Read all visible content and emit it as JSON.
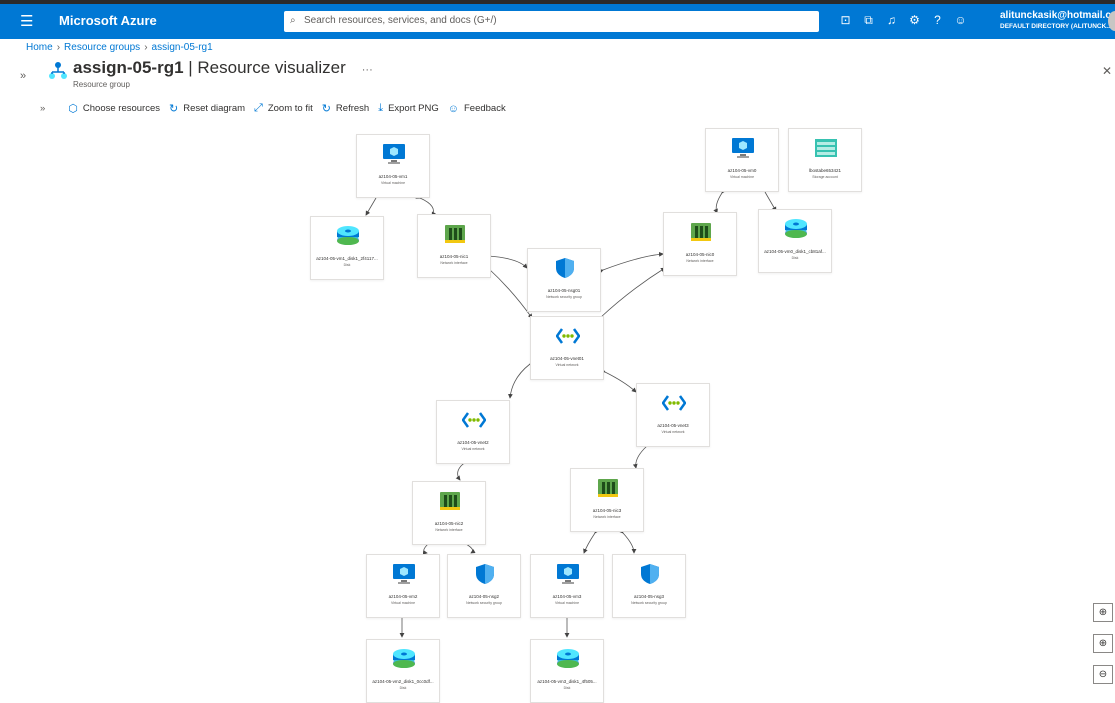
{
  "topbar": {
    "brand": "Microsoft Azure",
    "search_placeholder": "Search resources, services, and docs (G+/)",
    "user_email": "alitunckasik@hotmail.co...",
    "user_directory": "DEFAULT DIRECTORY (ALITUNCK...",
    "icons": [
      "cloud-shell-icon",
      "directory-filter-icon",
      "notifications-icon",
      "settings-icon",
      "help-icon",
      "feedback-icon"
    ]
  },
  "breadcrumb": [
    "Home",
    "Resource groups",
    "assign-05-rg1"
  ],
  "header": {
    "title_bold": "assign-05-rg1",
    "title_rest": " | Resource visualizer",
    "more": "···",
    "subtitle": "Resource group"
  },
  "toolbar": {
    "choose_resources": "Choose resources",
    "reset_diagram": "Reset diagram",
    "zoom_to_fit": "Zoom to fit",
    "refresh": "Refresh",
    "export_png": "Export PNG",
    "feedback": "Feedback"
  },
  "nodes": [
    {
      "id": "vm1",
      "kind": "vm",
      "name": "az104-05-vm1",
      "type": "Virtual machine"
    },
    {
      "id": "vm0",
      "kind": "vm",
      "name": "az104-05-vm0",
      "type": "Virtual machine"
    },
    {
      "id": "sa",
      "kind": "storage",
      "name": "lbostabe653421",
      "type": "Storage account"
    },
    {
      "id": "disk1",
      "kind": "disk",
      "name": "az104-05-vm1_disk1_2f4117...",
      "type": "Disk"
    },
    {
      "id": "nic1",
      "kind": "nic",
      "name": "az104-05-nic1",
      "type": "Network interface"
    },
    {
      "id": "nsg01",
      "kind": "nsg",
      "name": "az104-05-nsg01",
      "type": "Network security group"
    },
    {
      "id": "nic0",
      "kind": "nic",
      "name": "az104-05-nic0",
      "type": "Network interface"
    },
    {
      "id": "disk0",
      "kind": "disk",
      "name": "az104-05-vm0_disk1_cb81af...",
      "type": "Disk"
    },
    {
      "id": "vnet01",
      "kind": "vnet",
      "name": "az104-05-vnet01",
      "type": "Virtual network"
    },
    {
      "id": "vnet2",
      "kind": "vnet",
      "name": "az104-05-vnet2",
      "type": "Virtual network"
    },
    {
      "id": "vnet3",
      "kind": "vnet",
      "name": "az104-05-vnet3",
      "type": "Virtual network"
    },
    {
      "id": "nic2",
      "kind": "nic",
      "name": "az104-05-nic2",
      "type": "Network interface"
    },
    {
      "id": "nic3",
      "kind": "nic",
      "name": "az104-05-nic3",
      "type": "Network interface"
    },
    {
      "id": "vm2",
      "kind": "vm",
      "name": "az104-05-vm2",
      "type": "Virtual machine"
    },
    {
      "id": "nsg2",
      "kind": "nsg",
      "name": "az104-05-nsg2",
      "type": "Network security group"
    },
    {
      "id": "vm3",
      "kind": "vm",
      "name": "az104-05-vm3",
      "type": "Virtual machine"
    },
    {
      "id": "nsg3",
      "kind": "nsg",
      "name": "az104-05-nsg3",
      "type": "Network security group"
    },
    {
      "id": "disk2",
      "kind": "disk",
      "name": "az104-05-vm2_disk1_0cc0df...",
      "type": "Disk"
    },
    {
      "id": "disk3",
      "kind": "disk",
      "name": "az104-05-vm3_disk1_4f505...",
      "type": "Disk"
    }
  ],
  "zoom_controls": [
    "fit-center-icon",
    "zoom-in-icon",
    "zoom-out-icon"
  ]
}
